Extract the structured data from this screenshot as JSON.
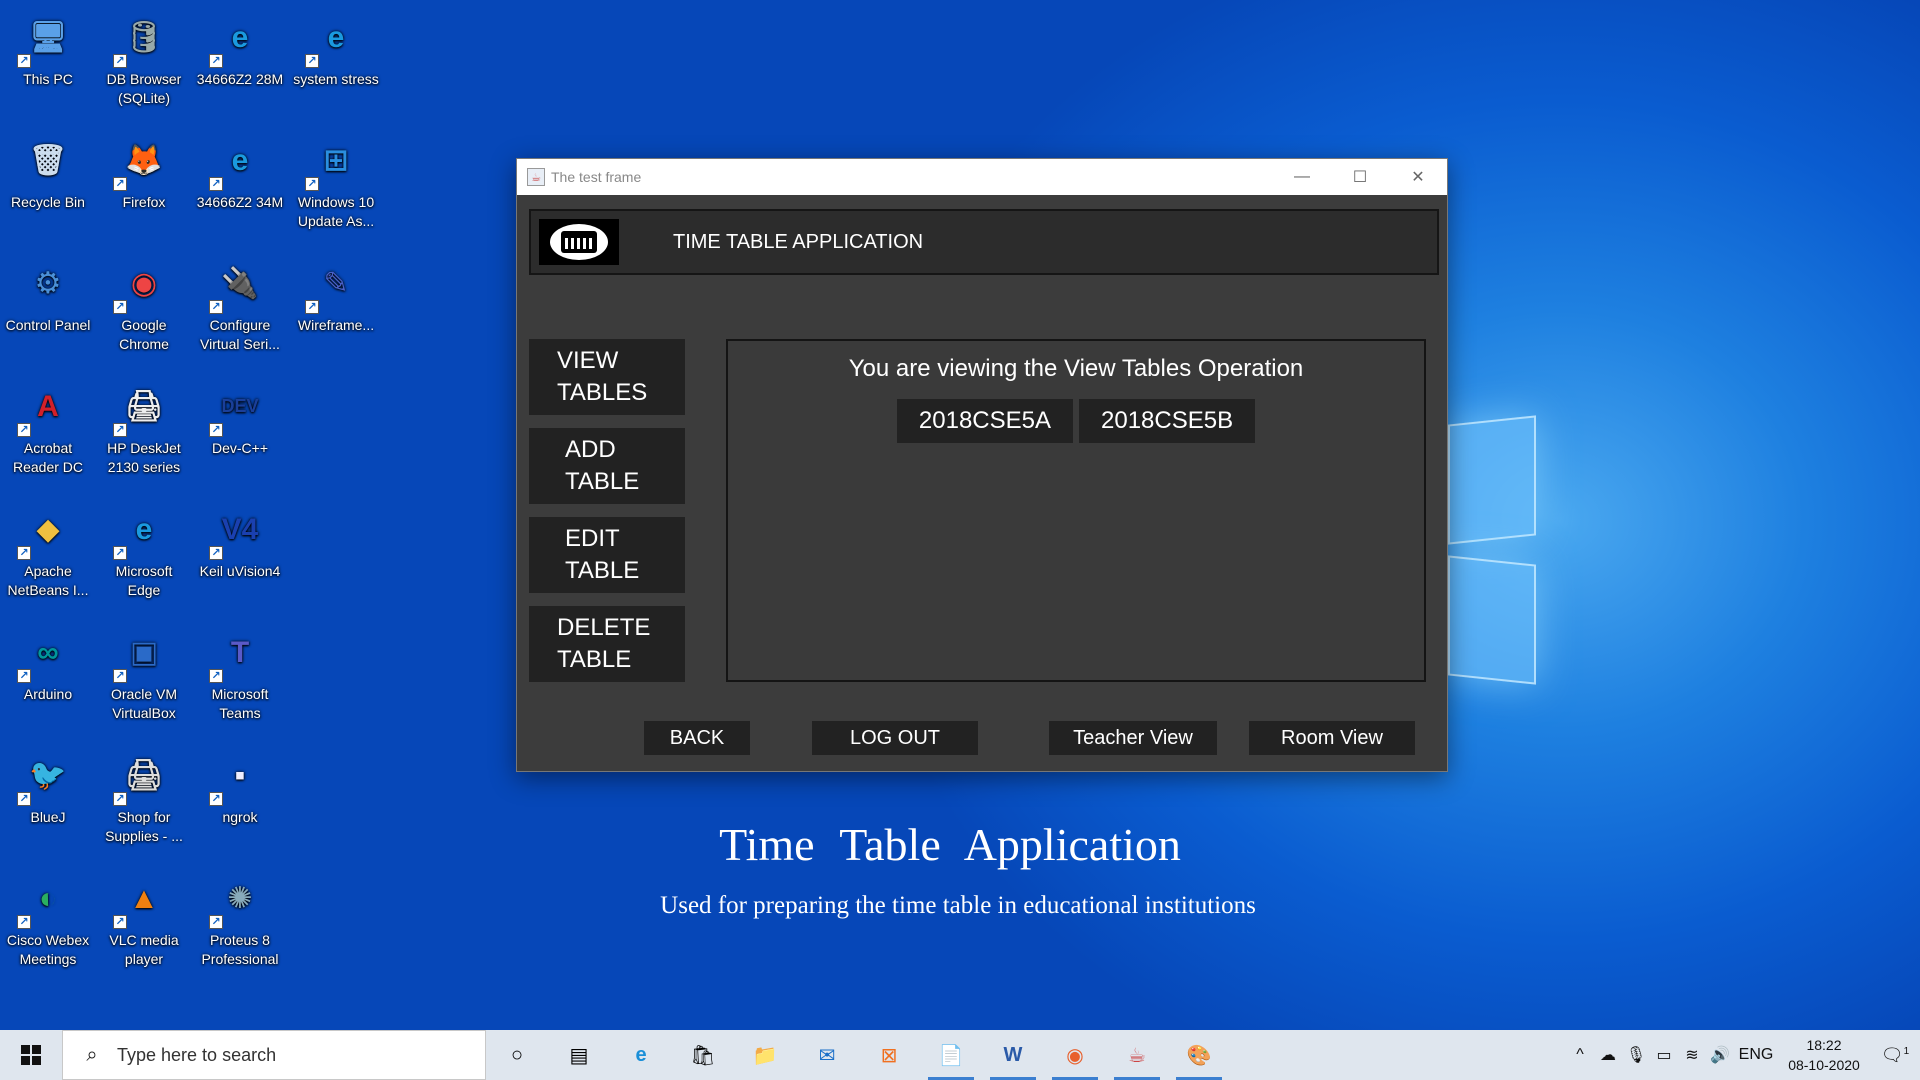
{
  "desktop": {
    "icons": [
      {
        "label": "This PC",
        "glyph": "🖥",
        "icon": "computer-icon"
      },
      {
        "label": "DB Browser (SQLite)",
        "glyph": "🛢",
        "icon": "database-icon"
      },
      {
        "label": "34666Z2 28M",
        "glyph": "e",
        "icon": "edge-icon"
      },
      {
        "label": "system stress",
        "glyph": "e",
        "icon": "edge-icon"
      },
      {
        "label": "Recycle Bin",
        "glyph": "🗑",
        "icon": "recycle-bin-icon"
      },
      {
        "label": "Firefox",
        "glyph": "🦊",
        "icon": "firefox-icon"
      },
      {
        "label": "34666Z2 34M",
        "glyph": "e",
        "icon": "edge-icon"
      },
      {
        "label": "Windows 10 Update As...",
        "glyph": "⊞",
        "icon": "windows-update-icon"
      },
      {
        "label": "Control Panel",
        "glyph": "⚙",
        "icon": "control-panel-icon"
      },
      {
        "label": "Google Chrome",
        "glyph": "◉",
        "icon": "chrome-icon"
      },
      {
        "label": "Configure Virtual Seri...",
        "glyph": "🔌",
        "icon": "serial-port-icon"
      },
      {
        "label": "Wireframe...",
        "glyph": "✎",
        "icon": "wireframe-icon"
      },
      {
        "label": "Acrobat Reader DC",
        "glyph": "A",
        "icon": "acrobat-icon"
      },
      {
        "label": "HP DeskJet 2130 series",
        "glyph": "🖨",
        "icon": "printer-icon"
      },
      {
        "label": "Dev-C++",
        "glyph": "DEV",
        "icon": "devcpp-icon"
      },
      {
        "label": "Apache NetBeans I...",
        "glyph": "◆",
        "icon": "netbeans-icon"
      },
      {
        "label": "Microsoft Edge",
        "glyph": "e",
        "icon": "edge-icon"
      },
      {
        "label": "Keil uVision4",
        "glyph": "V4",
        "icon": "keil-icon"
      },
      {
        "label": "Arduino",
        "glyph": "∞",
        "icon": "arduino-icon"
      },
      {
        "label": "Oracle VM VirtualBox",
        "glyph": "▣",
        "icon": "virtualbox-icon"
      },
      {
        "label": "Microsoft Teams",
        "glyph": "T",
        "icon": "teams-icon"
      },
      {
        "label": "BlueJ",
        "glyph": "🐦",
        "icon": "bluej-icon"
      },
      {
        "label": "Shop for Supplies - ...",
        "glyph": "🖨",
        "icon": "supplies-icon"
      },
      {
        "label": "ngrok",
        "glyph": "▪",
        "icon": "ngrok-icon"
      },
      {
        "label": "Cisco Webex Meetings",
        "glyph": "◐",
        "icon": "webex-icon"
      },
      {
        "label": "VLC media player",
        "glyph": "▲",
        "icon": "vlc-icon"
      },
      {
        "label": "Proteus 8 Professional",
        "glyph": "✺",
        "icon": "proteus-icon"
      }
    ],
    "promo_title": "Time Table Application",
    "promo_subtitle": "Used for preparing the time table in educational institutions"
  },
  "window": {
    "title": "The test frame",
    "minimize": "—",
    "maximize": "☐",
    "close": "✕",
    "app_title": "TIME TABLE APPLICATION",
    "side_buttons": [
      {
        "line1": "VIEW",
        "line2": "TABLES"
      },
      {
        "line1": "ADD",
        "line2": "TABLE"
      },
      {
        "line1": "EDIT",
        "line2": "TABLE"
      },
      {
        "line1": "DELETE",
        "line2": "TABLE"
      }
    ],
    "panel_heading": "You are viewing the View Tables Operation",
    "tables": [
      "2018CSE5A",
      "2018CSE5B"
    ],
    "bottom_buttons": {
      "back": "BACK",
      "logout": "LOG OUT",
      "teacher": "Teacher View",
      "room": "Room View"
    }
  },
  "taskbar": {
    "search_placeholder": "Type here to search",
    "language": "ENG",
    "time": "18:22",
    "date": "08-10-2020",
    "notifications": "1"
  }
}
